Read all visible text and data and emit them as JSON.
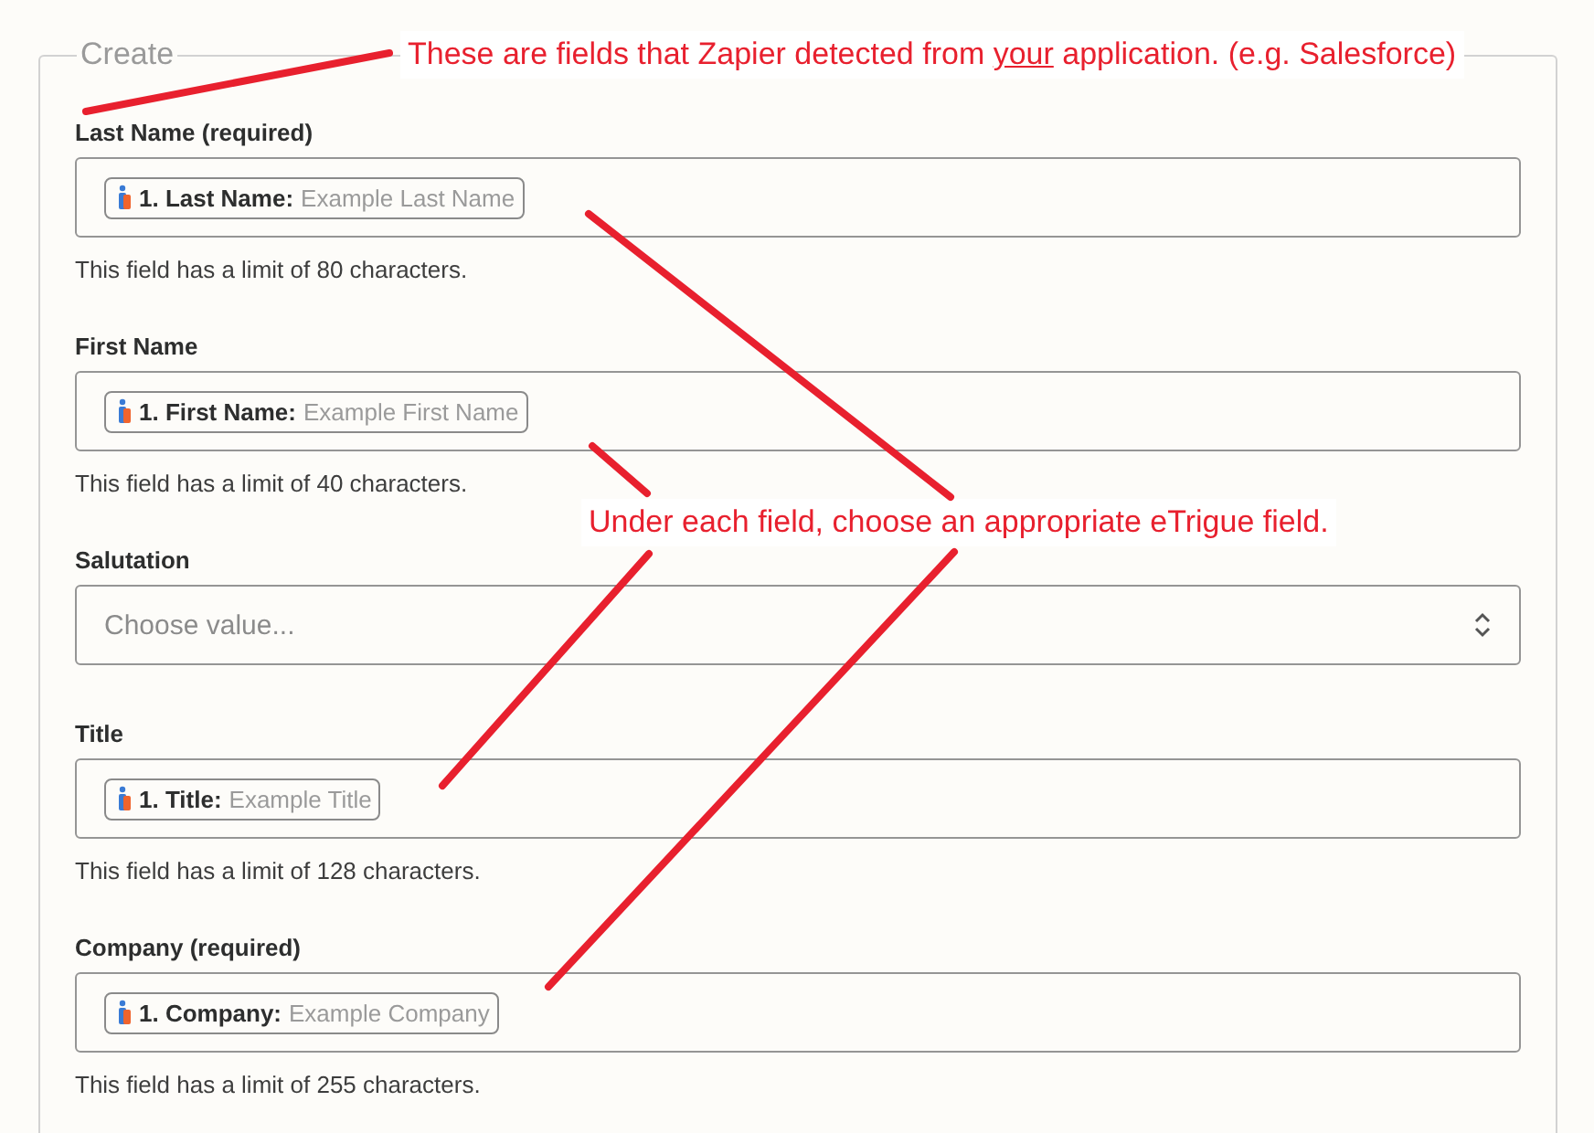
{
  "form": {
    "legend": "Create",
    "fields": [
      {
        "kind": "pill",
        "label": "Last Name (required)",
        "pill_key": "1. Last Name:",
        "pill_example": "Example Last Name",
        "help": "This field has a limit of 80 characters."
      },
      {
        "kind": "pill",
        "label": "First Name",
        "pill_key": "1. First Name:",
        "pill_example": "Example First Name",
        "help": "This field has a limit of 40 characters."
      },
      {
        "kind": "select",
        "label": "Salutation",
        "placeholder": "Choose value..."
      },
      {
        "kind": "pill",
        "label": "Title",
        "pill_key": "1. Title:",
        "pill_example": "Example Title",
        "help": "This field has a limit of 128 characters."
      },
      {
        "kind": "pill",
        "label": "Company (required)",
        "pill_key": "1. Company:",
        "pill_example": "Example Company",
        "help": "This field has a limit of 255 characters."
      }
    ]
  },
  "annotations": [
    {
      "segments": [
        {
          "text": "These are fields that Zapier detected from ",
          "underline": false
        },
        {
          "text": "your",
          "underline": true
        },
        {
          "text": " application. (e.g. Salesforce)",
          "underline": false
        }
      ]
    },
    {
      "segments": [
        {
          "text": "Under each field, choose an appropriate eTrigue field.",
          "underline": false
        }
      ]
    }
  ]
}
